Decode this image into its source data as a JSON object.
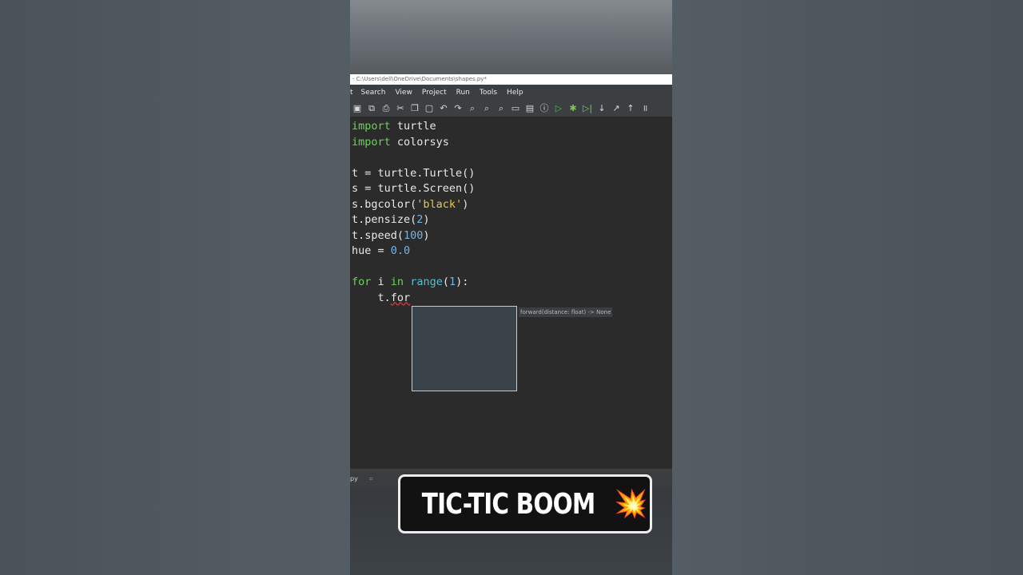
{
  "window": {
    "title_path": "- C:\\Users\\dell\\OneDrive\\Documents\\shapes.py*"
  },
  "menu": [
    "t",
    "Search",
    "View",
    "Project",
    "Run",
    "Tools",
    "Help"
  ],
  "toolbar_icons": [
    "new-file-icon",
    "copy-icon",
    "print-icon",
    "cut-icon",
    "paste-icon",
    "clipboard-icon",
    "undo-icon",
    "redo-icon",
    "find-icon",
    "find-replace-icon",
    "replace-icon",
    "folder-icon",
    "image-icon",
    "info-icon",
    "run-icon",
    "debug-icon",
    "step-into-icon",
    "step-over-icon",
    "step-out-icon",
    "stop-icon",
    "pause-icon"
  ],
  "code": [
    [
      {
        "t": "import",
        "c": "kw"
      },
      {
        "t": " turtle"
      }
    ],
    [
      {
        "t": "import",
        "c": "kw"
      },
      {
        "t": " colorsys"
      }
    ],
    [],
    [
      {
        "t": "t = turtle.Turtle()"
      }
    ],
    [
      {
        "t": "s = turtle.Screen()"
      }
    ],
    [
      {
        "t": "s.bgcolor("
      },
      {
        "t": "'black'",
        "c": "str"
      },
      {
        "t": ")"
      }
    ],
    [
      {
        "t": "t.pensize("
      },
      {
        "t": "2",
        "c": "num"
      },
      {
        "t": ")"
      }
    ],
    [
      {
        "t": "t.speed("
      },
      {
        "t": "100",
        "c": "num"
      },
      {
        "t": ")"
      }
    ],
    [
      {
        "t": "hue = "
      },
      {
        "t": "0.0",
        "c": "num"
      }
    ],
    [],
    [
      {
        "t": "for",
        "c": "kw"
      },
      {
        "t": " i "
      },
      {
        "t": "in",
        "c": "kw"
      },
      {
        "t": " "
      },
      {
        "t": "range",
        "c": "fn"
      },
      {
        "t": "("
      },
      {
        "t": "1",
        "c": "num"
      },
      {
        "t": "):"
      }
    ],
    [
      {
        "t": "    t."
      },
      {
        "t": "for",
        "c": "cursor-underline"
      }
    ]
  ],
  "calltip": "forward(distance: float) -> None",
  "bottom_tab": {
    "name": "py",
    "close": "⌗"
  },
  "banner": {
    "text": "TIC-TIC BOOM",
    "icon": "💥"
  }
}
